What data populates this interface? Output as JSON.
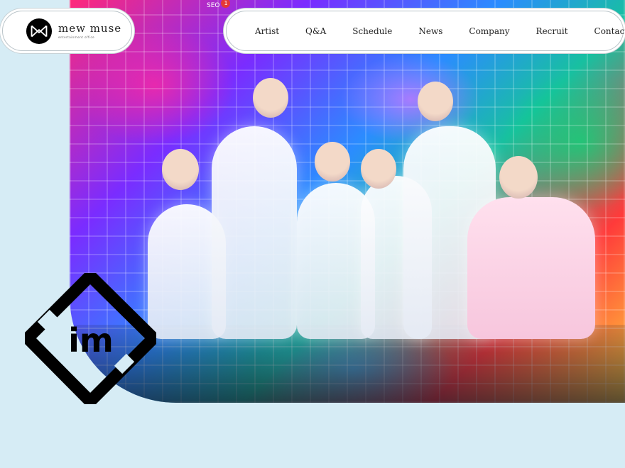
{
  "brand": {
    "title": "mew muse",
    "subtitle": "entertainment office",
    "logo_icon": "mew-muse-logo-mark"
  },
  "nav": {
    "items": [
      {
        "label": "Artist"
      },
      {
        "label": "Q&A"
      },
      {
        "label": "Schedule"
      },
      {
        "label": "News"
      },
      {
        "label": "Company"
      },
      {
        "label": "Recruit"
      },
      {
        "label": "Contact"
      }
    ]
  },
  "badge": {
    "label": "SEO",
    "count": "1"
  },
  "emblem": {
    "text": "im",
    "icon": "diamond-emblem-icon"
  },
  "colors": {
    "background": "#d6ecf5",
    "badge": "#e53935",
    "ink": "#000000"
  }
}
